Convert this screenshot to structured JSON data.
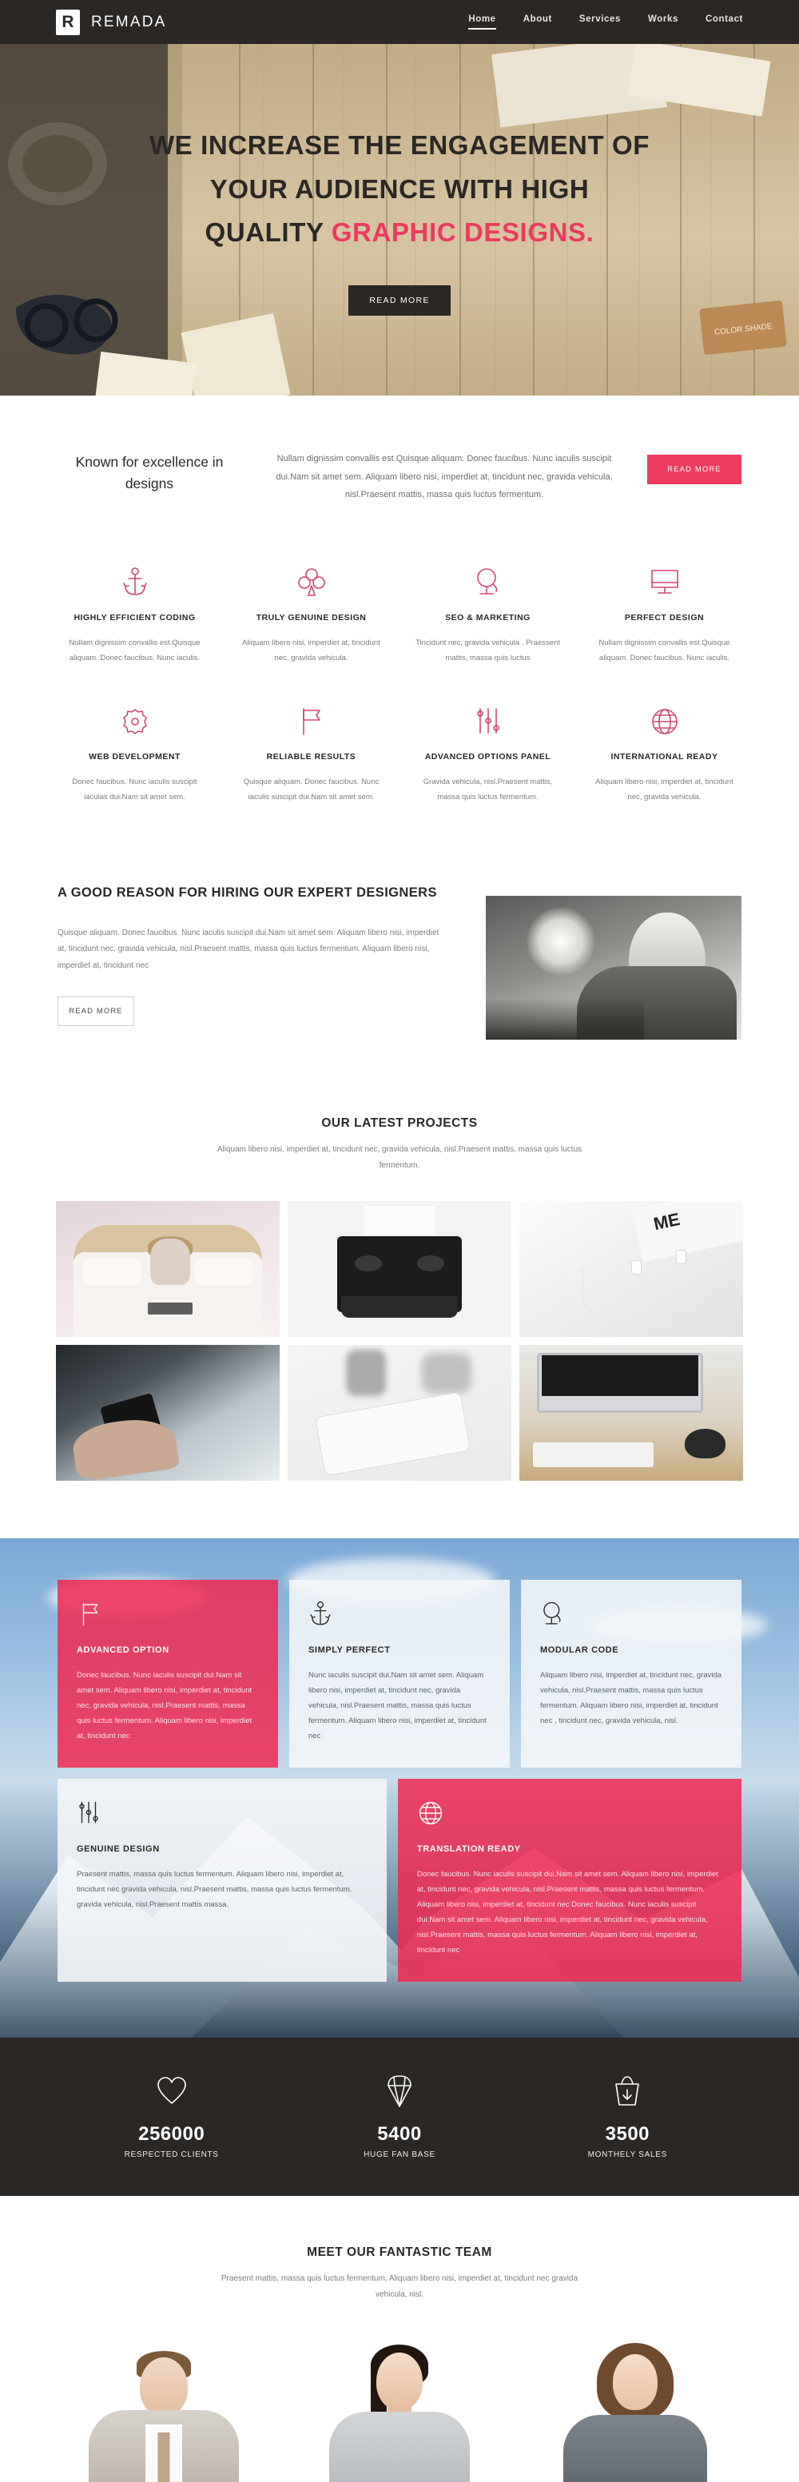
{
  "header": {
    "brand_mark": "R",
    "brand_name": "REMADA",
    "nav": [
      {
        "label": "Home",
        "active": true
      },
      {
        "label": "About",
        "active": false
      },
      {
        "label": "Services",
        "active": false
      },
      {
        "label": "Works",
        "active": false
      },
      {
        "label": "Contact",
        "active": false
      }
    ]
  },
  "hero": {
    "line1": "WE INCREASE THE ENGAGEMENT OF",
    "line2": "YOUR AUDIENCE WITH HIGH",
    "line3_plain": "QUALITY",
    "line3_accent": "GRAPHIC DESIGNS.",
    "button": "READ MORE"
  },
  "intro": {
    "title": "Known for excellence in designs",
    "text": "Nullam dignissim convallis est.Quisque aliquam. Donec faucibus. Nunc iaculis suscipit dui.Nam sit amet sem. Aliquam libero nisi, imperdiet at, tincidunt nec, gravida vehicula, nisl.Praesent mattis, massa quis luctus fermentum.",
    "button": "READ MORE"
  },
  "features": [
    {
      "icon": "anchor-icon",
      "title": "HIGHLY EFFICIENT CODING",
      "desc": "Nullam dignissim convallis est.Quisque aliquam. Donec faucibus. Nunc iaculis."
    },
    {
      "icon": "club-icon",
      "title": "TRULY GENUINE DESIGN",
      "desc": "Aliquam libero nisi, imperdiet at, tincidunt nec, gravida vehicula."
    },
    {
      "icon": "globe-stand-icon",
      "title": "SEO & MARKETING",
      "desc": "Tincidunt nec, gravida vehicula . Praessent mattis, massa quis luctus"
    },
    {
      "icon": "monitor-icon",
      "title": "PERFECT DESIGN",
      "desc": "Nullam dignissim convallis est.Quisque aliquam. Donec faucibus. Nunc iaculis."
    },
    {
      "icon": "gear-icon",
      "title": "WEB DEVELOPMENT",
      "desc": "Donec faucibus. Nunc iaculis suscipit iaculas dui.Nam sit amet sem."
    },
    {
      "icon": "flag-icon",
      "title": "RELIABLE RESULTS",
      "desc": "Quisque aliquam. Donec faucibus. Nunc iaculis suscipit dui.Nam sit amet sem."
    },
    {
      "icon": "sliders-icon",
      "title": "ADVANCED OPTIONS PANEL",
      "desc": "Gravida vehicula, nisl.Praesent mattis, massa quis luctus fermentum."
    },
    {
      "icon": "globe-grid-icon",
      "title": "INTERNATIONAL READY",
      "desc": "Aliquam libero nisi, imperdiet at, tincidunt nec, gravida vehicula."
    }
  ],
  "reason": {
    "title": "A GOOD REASON FOR HIRING OUR EXPERT DESIGNERS",
    "text": "Quisque aliquam. Donec faucibus. Nunc iaculis suscipit dui.Nam sit amet sem. Aliquam libero nisi, imperdiet at, tincidunt nec, gravida vehicula, nisl.Praesent mattis, massa quis luctus fermentum. Aliquam libero nisi, imperdiet at, tincidunt nec",
    "button": "READ MORE"
  },
  "projects": {
    "title": "OUR LATEST PROJECTS",
    "subtitle": "Aliquam libero nisi, imperdiet at, tincidunt nec, gravida vehicula, nisl.Praesent mattis, massa quis luctus fermentum.",
    "items": [
      {
        "name": "woman-on-bed-with-laptop"
      },
      {
        "name": "vintage-typewriter"
      },
      {
        "name": "earphones-and-magazine"
      },
      {
        "name": "hand-holding-smartphone"
      },
      {
        "name": "smartphone-on-desk"
      },
      {
        "name": "imac-keyboard-workspace"
      }
    ]
  },
  "services": {
    "cards": [
      {
        "icon": "flag-icon",
        "style": "pink",
        "title": "ADVANCED OPTION",
        "text": "Donec faucibus. Nunc iaculis suscipit dui.Nam sit amet sem. Aliquam libero nisi, imperdiet at, tincidunt nec, gravida vehicula, nisl.Praesent mattis, massa quis luctus fermentum. Aliquam libero nisi, imperdiet at, tincidunt nec"
      },
      {
        "icon": "anchor-icon",
        "style": "light",
        "title": "SIMPLY PERFECT",
        "text": "Nunc iaculis suscipit dui.Nam sit amet sem. Aliquam libero nisi, imperdiet at, tincidunt nec, gravida vehicula, nisl.Praesent mattis, massa quis luctus fermentum. Aliquam libero nisi, imperdiet at, tincidunt nec"
      },
      {
        "icon": "globe-stand-icon",
        "style": "light",
        "title": "MODULAR CODE",
        "text": "Aliquam libero nisi, imperdiet at, tincidunt nec, gravida vehicula, nisl.Praesent mattis, massa quis luctus fermentum. Aliquam libero nisi, imperdiet at, tincidunt nec , tincidunt nec, gravida vehicula, nisl."
      },
      {
        "icon": "sliders-icon",
        "style": "light",
        "title": "GENUINE DESIGN",
        "text": "Praesent mattis, massa quis luctus fermentum. Aliquam libero nisi, imperdiet at, tincidunt nec gravida vehicula, nisl.Praesent mattis, massa quis luctus fermentum. gravida vehicula, nisl.Praesent mattis massa."
      },
      {
        "icon": "globe-grid-icon",
        "style": "pink",
        "title": "TRANSLATION READY",
        "text": "Donec faucibus. Nunc iaculis suscipit dui.Nam sit amet sem. Aliquam libero nisi, imperdiet at, tincidunt nec, gravida vehicula, nisl.Praesent mattis, massa quis luctus fermentum. Aliquam libero nisi, imperdiet at, tincidunt nec Donec faucibus. Nunc iaculis suscipit dui.Nam sit amet sem. Aliquam libero nisi, imperdiet at, tincidunt nec, gravida vehicula, nisl.Praesent mattis, massa quis luctus fermentum. Aliquam libero nisi, imperdiet at, tincidunt nec"
      }
    ]
  },
  "counters": [
    {
      "icon": "heart-icon",
      "number": "256000",
      "label": "RESPECTED CLIENTS"
    },
    {
      "icon": "diamond-icon",
      "number": "5400",
      "label": "HUGE FAN BASE"
    },
    {
      "icon": "basket-icon",
      "number": "3500",
      "label": "MONTHELY SALES"
    }
  ],
  "team": {
    "title": "MEET OUR FANTASTIC TEAM",
    "subtitle": "Praesent mattis, massa quis luctus fermentum. Aliquam libero nisi, imperdiet at, tincidunt nec gravida vehicula, nisl.",
    "members": [
      {
        "name": "team-member-photo-1"
      },
      {
        "name": "team-member-photo-2"
      },
      {
        "name": "team-member-photo-3"
      }
    ]
  },
  "colors": {
    "accent_pink": "#ec3b5e",
    "dark": "#2b2724",
    "body_text": "#7b7b7b"
  }
}
